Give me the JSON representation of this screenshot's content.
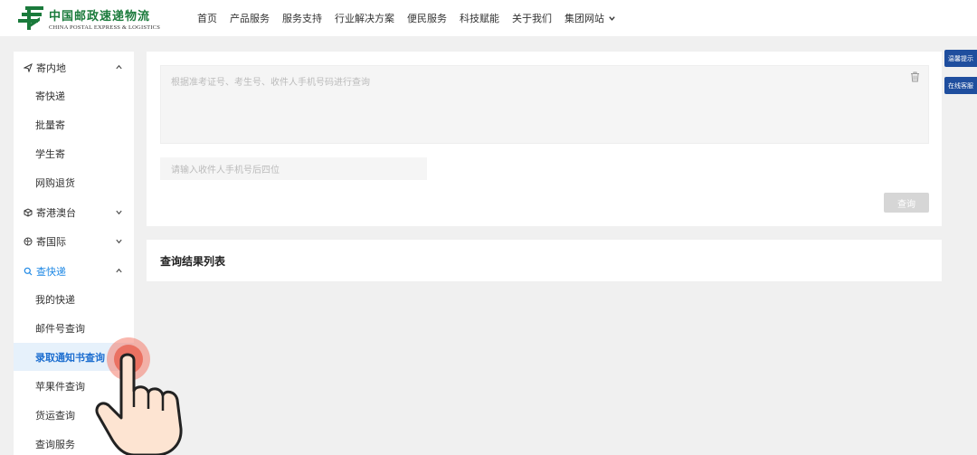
{
  "header": {
    "logo_cn": "中国邮政速递物流",
    "logo_en": "CHINA POSTAL EXPRESS & LOGISTICS",
    "nav": [
      {
        "label": "首页"
      },
      {
        "label": "产品服务"
      },
      {
        "label": "服务支持"
      },
      {
        "label": "行业解决方案"
      },
      {
        "label": "便民服务"
      },
      {
        "label": "科技赋能"
      },
      {
        "label": "关于我们"
      },
      {
        "label": "集团网站"
      }
    ]
  },
  "sidebar": {
    "groups": [
      {
        "label": "寄内地",
        "icon": "send-icon",
        "items": [
          "寄快递",
          "批量寄",
          "学生寄",
          "网购退货"
        ]
      },
      {
        "label": "寄港澳台",
        "icon": "box-icon",
        "items": []
      },
      {
        "label": "寄国际",
        "icon": "globe-icon",
        "items": []
      },
      {
        "label": "查快递",
        "icon": "search-icon",
        "items": [
          "我的快递",
          "邮件号查询",
          "录取通知书查询",
          "苹果件查询",
          "货运查询",
          "查询服务"
        ]
      }
    ],
    "selected": "录取通知书查询"
  },
  "query": {
    "textarea_placeholder": "根据准考证号、考生号、收件人手机号码进行查询",
    "phone_placeholder": "请输入收件人手机号后四位",
    "button_label": "查询"
  },
  "result": {
    "title": "查询结果列表"
  },
  "float": {
    "tip_label": "温馨提示",
    "service_label": "在线客服"
  },
  "colors": {
    "brand_green": "#1a7a3b",
    "active_blue": "#1e88e5",
    "float_blue": "#1f4e9e",
    "selected_bg": "#e6f1fb"
  }
}
